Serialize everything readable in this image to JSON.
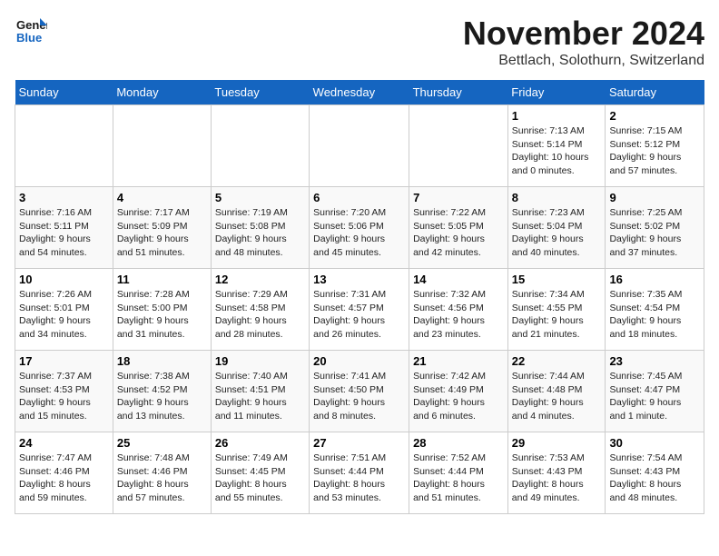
{
  "logo": {
    "line1": "General",
    "line2": "Blue"
  },
  "title": "November 2024",
  "location": "Bettlach, Solothurn, Switzerland",
  "days_of_week": [
    "Sunday",
    "Monday",
    "Tuesday",
    "Wednesday",
    "Thursday",
    "Friday",
    "Saturday"
  ],
  "weeks": [
    [
      {
        "day": "",
        "info": ""
      },
      {
        "day": "",
        "info": ""
      },
      {
        "day": "",
        "info": ""
      },
      {
        "day": "",
        "info": ""
      },
      {
        "day": "",
        "info": ""
      },
      {
        "day": "1",
        "info": "Sunrise: 7:13 AM\nSunset: 5:14 PM\nDaylight: 10 hours\nand 0 minutes."
      },
      {
        "day": "2",
        "info": "Sunrise: 7:15 AM\nSunset: 5:12 PM\nDaylight: 9 hours\nand 57 minutes."
      }
    ],
    [
      {
        "day": "3",
        "info": "Sunrise: 7:16 AM\nSunset: 5:11 PM\nDaylight: 9 hours\nand 54 minutes."
      },
      {
        "day": "4",
        "info": "Sunrise: 7:17 AM\nSunset: 5:09 PM\nDaylight: 9 hours\nand 51 minutes."
      },
      {
        "day": "5",
        "info": "Sunrise: 7:19 AM\nSunset: 5:08 PM\nDaylight: 9 hours\nand 48 minutes."
      },
      {
        "day": "6",
        "info": "Sunrise: 7:20 AM\nSunset: 5:06 PM\nDaylight: 9 hours\nand 45 minutes."
      },
      {
        "day": "7",
        "info": "Sunrise: 7:22 AM\nSunset: 5:05 PM\nDaylight: 9 hours\nand 42 minutes."
      },
      {
        "day": "8",
        "info": "Sunrise: 7:23 AM\nSunset: 5:04 PM\nDaylight: 9 hours\nand 40 minutes."
      },
      {
        "day": "9",
        "info": "Sunrise: 7:25 AM\nSunset: 5:02 PM\nDaylight: 9 hours\nand 37 minutes."
      }
    ],
    [
      {
        "day": "10",
        "info": "Sunrise: 7:26 AM\nSunset: 5:01 PM\nDaylight: 9 hours\nand 34 minutes."
      },
      {
        "day": "11",
        "info": "Sunrise: 7:28 AM\nSunset: 5:00 PM\nDaylight: 9 hours\nand 31 minutes."
      },
      {
        "day": "12",
        "info": "Sunrise: 7:29 AM\nSunset: 4:58 PM\nDaylight: 9 hours\nand 28 minutes."
      },
      {
        "day": "13",
        "info": "Sunrise: 7:31 AM\nSunset: 4:57 PM\nDaylight: 9 hours\nand 26 minutes."
      },
      {
        "day": "14",
        "info": "Sunrise: 7:32 AM\nSunset: 4:56 PM\nDaylight: 9 hours\nand 23 minutes."
      },
      {
        "day": "15",
        "info": "Sunrise: 7:34 AM\nSunset: 4:55 PM\nDaylight: 9 hours\nand 21 minutes."
      },
      {
        "day": "16",
        "info": "Sunrise: 7:35 AM\nSunset: 4:54 PM\nDaylight: 9 hours\nand 18 minutes."
      }
    ],
    [
      {
        "day": "17",
        "info": "Sunrise: 7:37 AM\nSunset: 4:53 PM\nDaylight: 9 hours\nand 15 minutes."
      },
      {
        "day": "18",
        "info": "Sunrise: 7:38 AM\nSunset: 4:52 PM\nDaylight: 9 hours\nand 13 minutes."
      },
      {
        "day": "19",
        "info": "Sunrise: 7:40 AM\nSunset: 4:51 PM\nDaylight: 9 hours\nand 11 minutes."
      },
      {
        "day": "20",
        "info": "Sunrise: 7:41 AM\nSunset: 4:50 PM\nDaylight: 9 hours\nand 8 minutes."
      },
      {
        "day": "21",
        "info": "Sunrise: 7:42 AM\nSunset: 4:49 PM\nDaylight: 9 hours\nand 6 minutes."
      },
      {
        "day": "22",
        "info": "Sunrise: 7:44 AM\nSunset: 4:48 PM\nDaylight: 9 hours\nand 4 minutes."
      },
      {
        "day": "23",
        "info": "Sunrise: 7:45 AM\nSunset: 4:47 PM\nDaylight: 9 hours\nand 1 minute."
      }
    ],
    [
      {
        "day": "24",
        "info": "Sunrise: 7:47 AM\nSunset: 4:46 PM\nDaylight: 8 hours\nand 59 minutes."
      },
      {
        "day": "25",
        "info": "Sunrise: 7:48 AM\nSunset: 4:46 PM\nDaylight: 8 hours\nand 57 minutes."
      },
      {
        "day": "26",
        "info": "Sunrise: 7:49 AM\nSunset: 4:45 PM\nDaylight: 8 hours\nand 55 minutes."
      },
      {
        "day": "27",
        "info": "Sunrise: 7:51 AM\nSunset: 4:44 PM\nDaylight: 8 hours\nand 53 minutes."
      },
      {
        "day": "28",
        "info": "Sunrise: 7:52 AM\nSunset: 4:44 PM\nDaylight: 8 hours\nand 51 minutes."
      },
      {
        "day": "29",
        "info": "Sunrise: 7:53 AM\nSunset: 4:43 PM\nDaylight: 8 hours\nand 49 minutes."
      },
      {
        "day": "30",
        "info": "Sunrise: 7:54 AM\nSunset: 4:43 PM\nDaylight: 8 hours\nand 48 minutes."
      }
    ]
  ]
}
